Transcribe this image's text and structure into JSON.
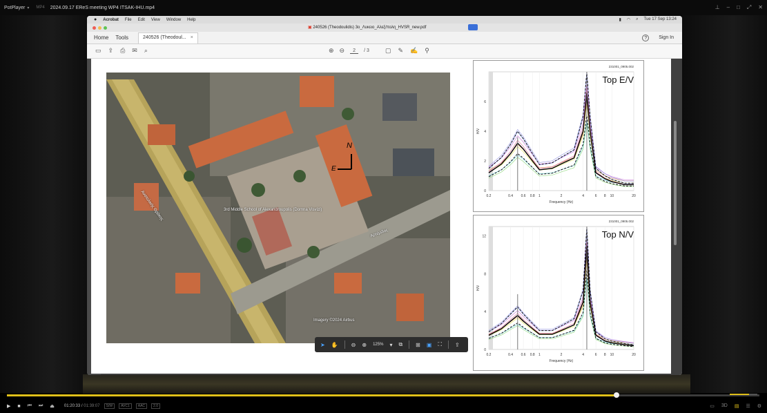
{
  "player": {
    "app_name": "PotPlayer",
    "format": "MP4",
    "file_name": "2024.09.17 EReS meeting WP4 ITSAK-IHU.mp4",
    "time_current": "01:20:33",
    "time_total": "01:39:07",
    "tags": [
      "S/W",
      "AVC1",
      "AAC",
      "2.0"
    ],
    "progress": 0.81,
    "volume": 0.7
  },
  "mac": {
    "menu": [
      "Acrobat",
      "File",
      "Edit",
      "View",
      "Window",
      "Help"
    ],
    "datetime": "Tue 17 Sep 13:24",
    "doc_title": "240526 (Theodoulidis) 3o_Λυκειο_Αλεξ/πολη_HVSR_new.pdf"
  },
  "acrobat": {
    "nav_home": "Home",
    "nav_tools": "Tools",
    "tab_label": "240526 (Theodoul...",
    "sign_in": "Sign In",
    "page_current": "2",
    "page_total": "/ 3",
    "zoom": "125%"
  },
  "map": {
    "school_label": "3rd Middle School of Alexandroupolis (Domna Visvizi)",
    "copyright": "Imagery ©2024 Airbus",
    "street_1": "Ανατολικής Θράκης",
    "street_2": "Αρτέμιδος",
    "north": "N",
    "east": "E"
  },
  "chart_data": [
    {
      "type": "line",
      "title": "Top  E/V",
      "station_id": "231001_0905.002",
      "xlabel": "Frequency (Hz)",
      "ylabel": "H/V",
      "x_scale": "log",
      "xlim": [
        0.2,
        20
      ],
      "ylim": [
        0,
        8
      ],
      "xticks": [
        "0.2",
        "0.4",
        "0.6",
        "0.8",
        "1",
        "2",
        "4",
        "6",
        "8",
        "10",
        "20"
      ],
      "yticks": [
        "0",
        "2",
        "4",
        "6"
      ],
      "series": [
        {
          "style": "mean-dashed",
          "x": [
            0.2,
            0.3,
            0.4,
            0.5,
            0.6,
            0.8,
            1,
            1.5,
            2,
            3,
            4,
            4.5,
            5,
            6,
            8,
            10,
            15,
            20
          ],
          "y": [
            1.2,
            1.8,
            2.5,
            3.2,
            2.8,
            2.0,
            1.4,
            1.5,
            1.8,
            2.2,
            4.0,
            6.6,
            4.0,
            1.2,
            0.8,
            0.6,
            0.4,
            0.4
          ]
        }
      ]
    },
    {
      "type": "line",
      "title": "Top N/V",
      "station_id": "231001_0905.002",
      "xlabel": "Frequency (Hz)",
      "ylabel": "H/V",
      "x_scale": "log",
      "xlim": [
        0.2,
        20
      ],
      "ylim": [
        0,
        13
      ],
      "xticks": [
        "0.2",
        "0.4",
        "0.6",
        "0.8",
        "1",
        "2",
        "4",
        "6",
        "8",
        "10",
        "20"
      ],
      "yticks": [
        "0",
        "4",
        "8",
        "12"
      ],
      "series": [
        {
          "style": "mean-dashed",
          "x": [
            0.2,
            0.3,
            0.4,
            0.5,
            0.6,
            0.8,
            1,
            1.5,
            2,
            3,
            4,
            4.5,
            5,
            6,
            8,
            10,
            15,
            20
          ],
          "y": [
            1.5,
            2.2,
            3.0,
            3.6,
            3.0,
            2.2,
            1.6,
            1.6,
            2.0,
            2.6,
            5.0,
            11.0,
            5.0,
            1.5,
            0.9,
            0.7,
            0.5,
            0.4
          ]
        }
      ]
    }
  ],
  "colors": {
    "seek": "#e0c019",
    "roof": "#c96a3f",
    "road": "#b6a35a"
  }
}
